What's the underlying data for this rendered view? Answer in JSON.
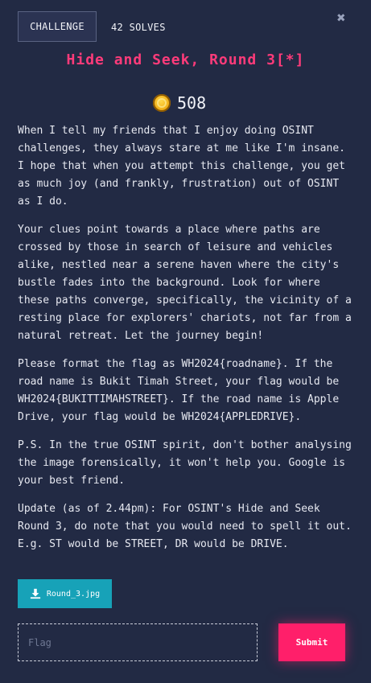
{
  "header": {
    "tab_label": "CHALLENGE",
    "solves": "42 SOLVES",
    "close_icon": "✖"
  },
  "challenge": {
    "title": "Hide and Seek, Round 3[*]",
    "points": "508",
    "description": [
      "When I tell my friends that I enjoy doing OSINT challenges, they always stare at me like I'm insane. I hope that when you attempt this challenge, you get as much joy (and frankly, frustration) out of OSINT as I do.",
      "Your clues point towards a place where paths are crossed by those in search of leisure and vehicles alike, nestled near a serene haven where the city's bustle fades into the background. Look for where these paths converge, specifically, the vicinity of a resting place for explorers' chariots, not far from a natural retreat. Let the journey begin!",
      "Please format the flag as WH2024{roadname}. If the road name is Bukit Timah Street, your flag would be WH2024{BUKITTIMAHSTREET}. If the road name is Apple Drive, your flag would be WH2024{APPLEDRIVE}.",
      "P.S. In the true OSINT spirit, don't bother analysing the image forensically, it won't help you. Google is your best friend.",
      "Update (as of 2.44pm): For OSINT's Hide and Seek Round 3, do note that you would need to spell it out. E.g. ST would be STREET, DR would be DRIVE."
    ],
    "file": "Round_3.jpg"
  },
  "form": {
    "flag_placeholder": "Flag",
    "flag_value": "",
    "submit_label": "Submit"
  },
  "colors": {
    "background": "#222a44",
    "title": "#ff3b7a",
    "file_button": "#17a2b8",
    "submit_button": "#ff1f6a"
  }
}
